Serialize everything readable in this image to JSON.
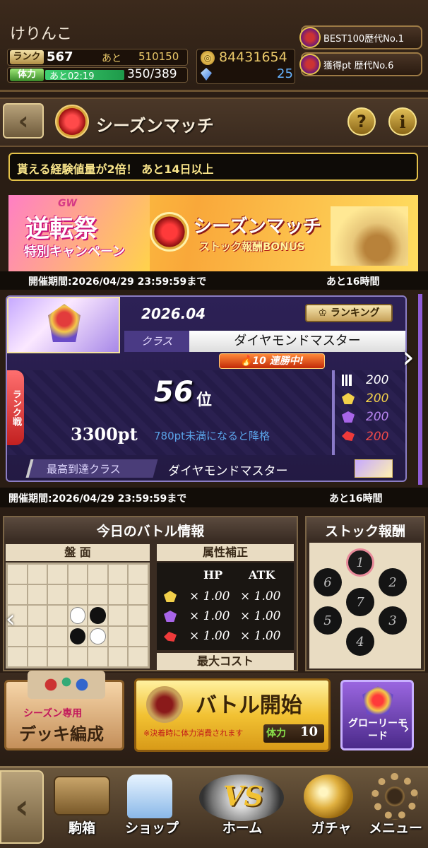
{
  "player": {
    "name": "けりんこ",
    "rank_label": "ランク",
    "rank": "567",
    "next_label": "あと",
    "next_exp": "510150",
    "stamina_label": "体力",
    "stamina_timer": "あと02:19",
    "stamina": "350/389",
    "coins": "84431654",
    "gems": "25"
  },
  "titles": [
    {
      "label": "BEST100歴代No.1"
    },
    {
      "label": "獲得pt 歴代No.6"
    }
  ],
  "header": {
    "title": "シーズンマッチ",
    "help": "?",
    "info": "i"
  },
  "notice": "貰える経験値量が2倍！ あと14日以上",
  "banner": {
    "gw": "GW",
    "left_title": "逆転祭",
    "left_sub": "特別キャンペーン",
    "right_title": "シーズンマッチ",
    "right_sub": "ストック報酬BONUS",
    "period": "開催期間:2026/04/29 23:59:59まで",
    "remaining": "あと16時間"
  },
  "season": {
    "month": "2026.04",
    "ranking_label": "ランキング",
    "class_label": "クラス",
    "class_name": "ダイヤモンドマスター",
    "streak": "10 連勝中!",
    "rank_battle": "ランク戦",
    "rank_pos": "56",
    "rank_unit": "位",
    "points": "3300pt",
    "demote_note": "780pt未満になると降格",
    "stats": [
      "200",
      "200",
      "200",
      "200"
    ],
    "best_label": "最高到達クラス",
    "best_class": "ダイヤモンドマスター",
    "period": "開催期間:2026/04/29 23:59:59まで",
    "remaining": "あと16時間"
  },
  "today": {
    "title": "今日のバトル情報",
    "board_label": "盤 面",
    "attr_label": "属性補正",
    "hp": "HP",
    "atk": "ATK",
    "rows": [
      [
        "× 1.00",
        "× 1.00"
      ],
      [
        "× 1.00",
        "× 1.00"
      ],
      [
        "× 1.00",
        "× 1.00"
      ]
    ],
    "max_cost": "最大コスト"
  },
  "stock": {
    "title": "ストック報酬",
    "nodes": [
      "1",
      "2",
      "3",
      "4",
      "5",
      "6",
      "7"
    ]
  },
  "actions": {
    "deck_tag": "シーズン専用",
    "deck_label": "デッキ編成",
    "battle_label": "バトル開始",
    "battle_note": "※決着時に体力消費されます",
    "cost_label": "体力",
    "cost": "10",
    "glory_label": "グローリーモード"
  },
  "nav": {
    "items": [
      "駒箱",
      "ショップ",
      "ホーム",
      "ガチャ",
      "メニュー"
    ]
  },
  "colors": {
    "accent_gold": "#e4c24a",
    "stat_yellow": "#f2d04a",
    "stat_purple": "#a865e8",
    "stat_red": "#ef3a3a",
    "demote_blue": "#5aa3e8"
  }
}
